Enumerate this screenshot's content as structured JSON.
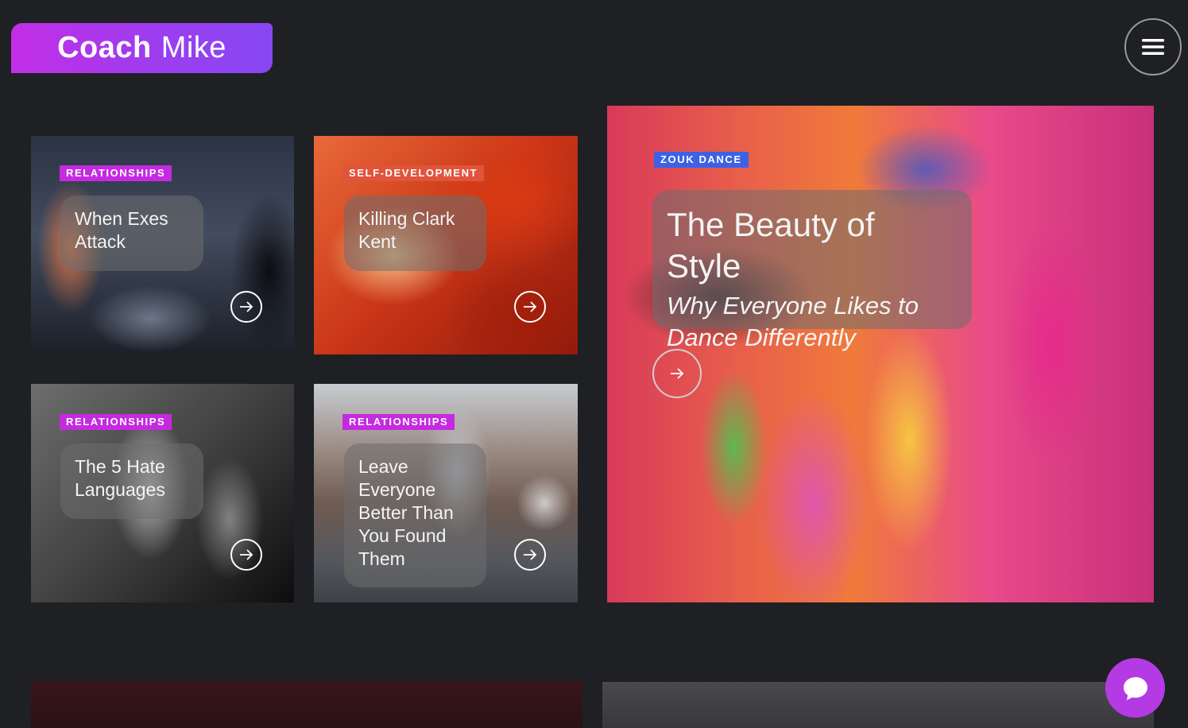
{
  "logo": {
    "bold": "Coach",
    "light": "Mike"
  },
  "header": {
    "menu_icon": "hamburger-icon"
  },
  "cards": [
    {
      "category": "RELATIONSHIPS",
      "title": "When Exes Attack",
      "arrow_icon": "arrow-right-icon"
    },
    {
      "category": "SELF-DEVELOPMENT",
      "title": "Killing Clark Kent",
      "arrow_icon": "arrow-right-icon"
    },
    {
      "category": "RELATIONSHIPS",
      "title": "The 5 Hate Languages",
      "arrow_icon": "arrow-right-icon"
    },
    {
      "category": "RELATIONSHIPS",
      "title": "Leave Everyone Better Than You Found Them",
      "arrow_icon": "arrow-right-icon"
    }
  ],
  "featured": {
    "category": "ZOUK DANCE",
    "title": "The Beauty of Style",
    "subtitle": "Why Everyone Likes to Dance Differently",
    "arrow_icon": "arrow-right-icon"
  },
  "chat": {
    "icon": "chat-bubble-icon"
  },
  "colors": {
    "accent_pink": "#c52ae0",
    "accent_orange": "#e0543b",
    "accent_blue": "#3b62e6",
    "background": "#1f2023"
  }
}
